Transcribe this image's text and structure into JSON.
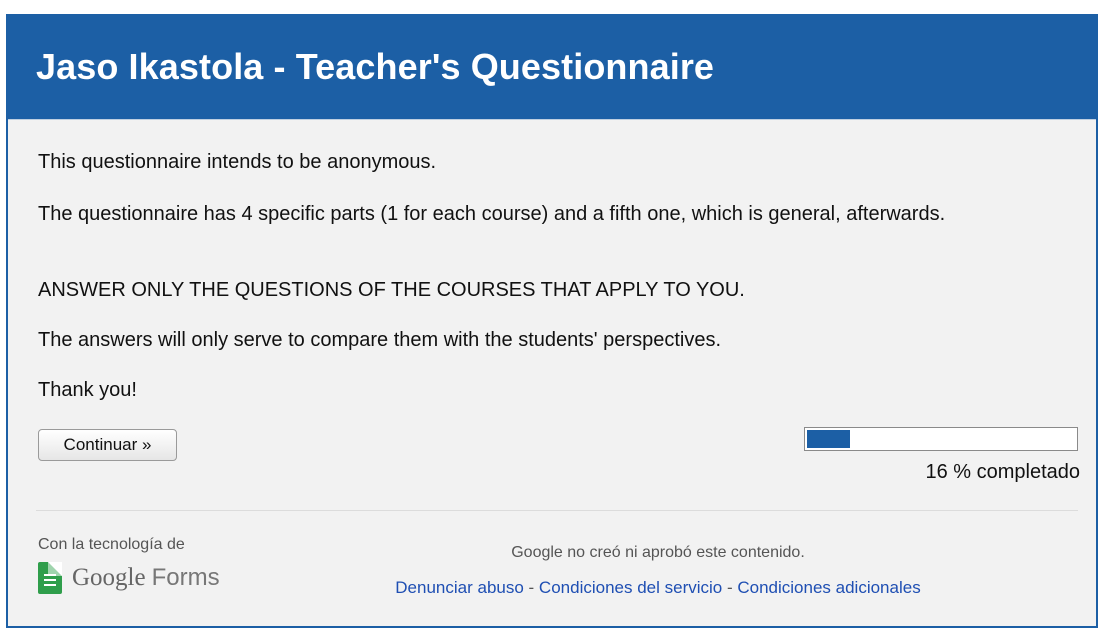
{
  "form": {
    "title": "Jaso Ikastola - Teacher's Questionnaire",
    "description": [
      "This questionnaire intends to be anonymous.",
      "The questionnaire has 4 specific parts (1 for each course) and a fifth one, which is general, afterwards.",
      "ANSWER ONLY THE QUESTIONS OF THE COURSES THAT APPLY TO YOU.",
      "The answers will only serve to compare them with the students' perspectives.",
      "Thank you!"
    ],
    "continue_label": "Continuar »",
    "progress": {
      "percent": 16,
      "label": "16 % completado",
      "fill_color": "#1c5fa5"
    }
  },
  "footer": {
    "powered_by": "Con la tecnología de",
    "brand_google": "Google",
    "brand_forms": "Forms",
    "brand_icon": "google-forms-icon",
    "disclaimer": "Google no creó ni aprobó este contenido.",
    "links": [
      "Denunciar abuso",
      "Condiciones del servicio",
      "Condiciones adicionales"
    ],
    "separator": " - "
  },
  "colors": {
    "header_bg": "#1c5fa5",
    "page_bg": "#f2f2f2",
    "link": "#1f4fb3"
  }
}
